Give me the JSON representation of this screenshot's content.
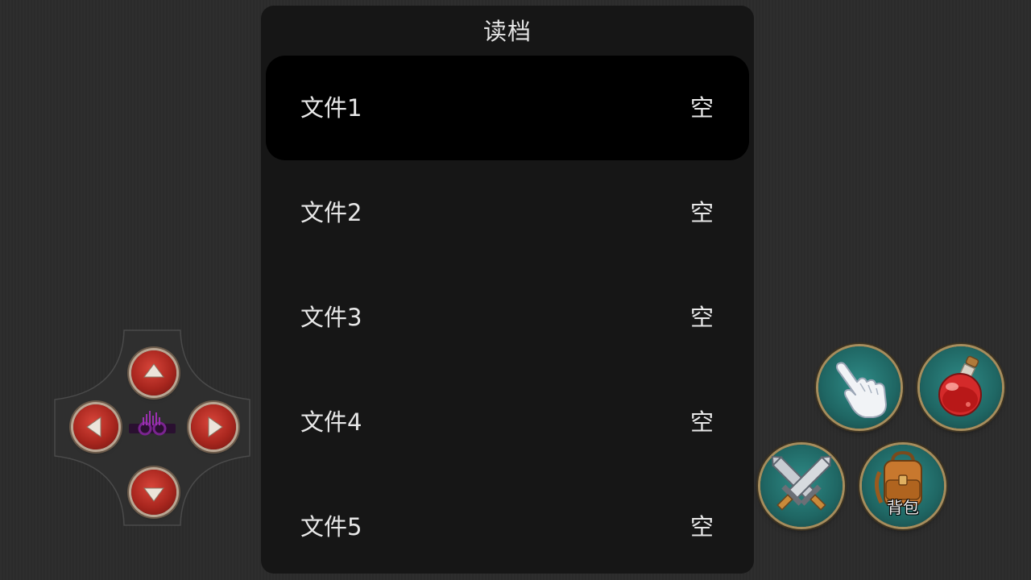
{
  "dialog": {
    "title": "读档",
    "selected_index": 0,
    "slots": [
      {
        "name": "文件1",
        "status": "空"
      },
      {
        "name": "文件2",
        "status": "空"
      },
      {
        "name": "文件3",
        "status": "空"
      },
      {
        "name": "文件4",
        "status": "空"
      },
      {
        "name": "文件5",
        "status": "空"
      }
    ]
  },
  "dpad": {
    "up_icon": "arrow-up-icon",
    "down_icon": "arrow-down-icon",
    "left_icon": "arrow-left-icon",
    "right_icon": "arrow-right-icon",
    "center_icon": "purple-emblem-icon"
  },
  "actions": {
    "interact_icon": "pointing-hand-icon",
    "potion_icon": "red-potion-icon",
    "attack_icon": "crossed-swords-icon",
    "bag_icon": "backpack-icon",
    "bag_label": "背包"
  },
  "colors": {
    "dialog_bg": "#161616",
    "selected_row_bg": "#000000",
    "button_red": "#a8261e",
    "button_teal": "#1f6663",
    "emblem_purple": "#8a2a9a"
  }
}
